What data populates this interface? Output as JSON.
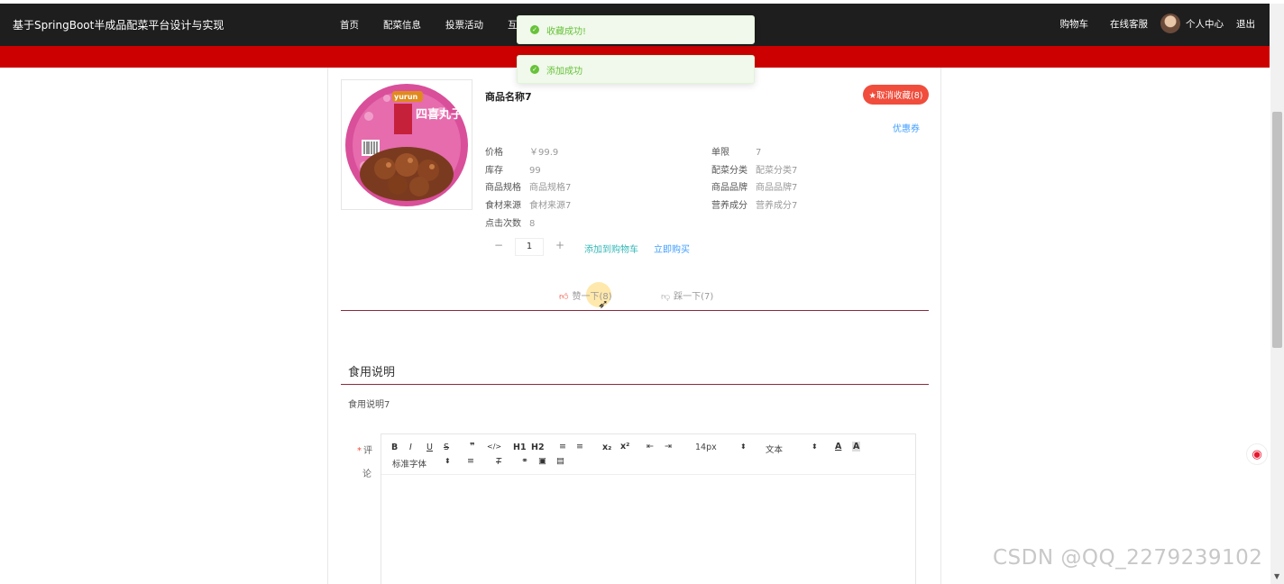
{
  "header": {
    "site_title": "基于SpringBoot半成品配菜平台设计与实现",
    "nav": [
      "首页",
      "配菜信息",
      "投票活动",
      "互动"
    ],
    "cart": "购物车",
    "service": "在线客服",
    "user": "个人中心",
    "logout": "退出"
  },
  "toasts": [
    {
      "message": "收藏成功!"
    },
    {
      "message": "添加成功"
    }
  ],
  "product": {
    "name": "商品名称7",
    "fav_button": "★取消收藏(8)",
    "coupon": "优惠券",
    "attrs": [
      {
        "label": "价格",
        "value": "￥99.9"
      },
      {
        "label": "单限",
        "value": "7"
      },
      {
        "label": "库存",
        "value": "99"
      },
      {
        "label": "配菜分类",
        "value": "配菜分类7"
      },
      {
        "label": "商品规格",
        "value": "商品规格7"
      },
      {
        "label": "商品品牌",
        "value": "商品品牌7"
      },
      {
        "label": "食材来源",
        "value": "食材来源7"
      },
      {
        "label": "营养成分",
        "value": "营养成分7"
      },
      {
        "label": "点击次数",
        "value": "8"
      }
    ],
    "image": {
      "brand": "yurun",
      "text": "四喜丸子"
    },
    "quantity": "1",
    "add_to_cart": "添加到购物车",
    "buy_now": "立即购买",
    "like": "赞一下(8)",
    "dislike": "踩一下(7)"
  },
  "usage": {
    "title": "食用说明",
    "body": "食用说明7"
  },
  "comment": {
    "label_required": "*",
    "label_1": "评",
    "label_2": "论",
    "toolbar": {
      "bold": "B",
      "italic": "I",
      "underline": "U",
      "strike": "S",
      "quote": "❞",
      "code": "</>",
      "h1": "H1",
      "h2": "H2",
      "ol": "≡",
      "ul": "≡",
      "sub": "x₂",
      "sup": "x²",
      "outdent": "⇤",
      "indent": "⇥",
      "size": "14px",
      "size_caret": "⬍",
      "header_select": "文本",
      "header_caret": "⬍",
      "color": "A",
      "bg": "A",
      "font": "标准字体",
      "font_caret": "⬍",
      "align": "≡",
      "clean": "T",
      "link": "⚭",
      "image": "▣",
      "video": "▤"
    }
  },
  "watermark": "CSDN @QQ_2279239102",
  "share": {
    "weibo": "◉"
  },
  "colors": {
    "accent": "#cc0000",
    "fav": "#f04d3c",
    "success": "#67c23a",
    "link": "#409eff"
  }
}
